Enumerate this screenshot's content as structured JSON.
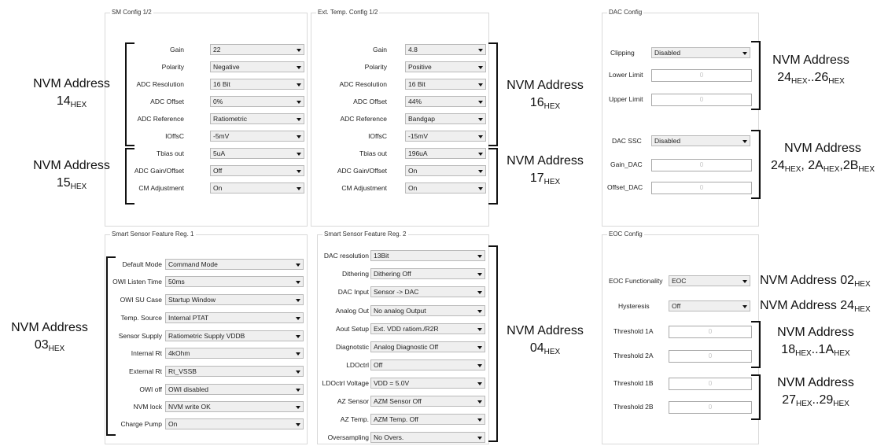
{
  "sm_config": {
    "title": "SM Config 1/2",
    "rows": [
      {
        "label": "Gain",
        "value": "22"
      },
      {
        "label": "Polarity",
        "value": "Negative"
      },
      {
        "label": "ADC Resolution",
        "value": "16 Bit"
      },
      {
        "label": "ADC Offset",
        "value": "0%"
      },
      {
        "label": "ADC Reference",
        "value": "Ratiometric"
      },
      {
        "label": "IOffsC",
        "value": "-5mV"
      },
      {
        "label": "Tbias out",
        "value": "5uA"
      },
      {
        "label": "ADC Gain/Offset",
        "value": "Off"
      },
      {
        "label": "CM Adjustment",
        "value": "On"
      }
    ]
  },
  "ext_temp_config": {
    "title": "Ext. Temp. Config 1/2",
    "rows": [
      {
        "label": "Gain",
        "value": "4.8"
      },
      {
        "label": "Polarity",
        "value": "Positive"
      },
      {
        "label": "ADC Resolution",
        "value": "16 Bit"
      },
      {
        "label": "ADC Offset",
        "value": "44%"
      },
      {
        "label": "ADC Reference",
        "value": "Bandgap"
      },
      {
        "label": "IOffsC",
        "value": "-15mV"
      },
      {
        "label": "Tbias out",
        "value": "196uA"
      },
      {
        "label": "ADC Gain/Offset",
        "value": "On"
      },
      {
        "label": "CM Adjustment",
        "value": "On"
      }
    ]
  },
  "dac_config": {
    "title": "DAC Config",
    "clipping": {
      "label": "Clipping",
      "value": "Disabled"
    },
    "lower_limit": {
      "label": "Lower Limit",
      "value": "0"
    },
    "upper_limit": {
      "label": "Upper Limit",
      "value": "0"
    },
    "dac_ssc": {
      "label": "DAC SSC",
      "value": "Disabled"
    },
    "gain_dac": {
      "label": "Gain_DAC",
      "value": "0"
    },
    "offset_dac": {
      "label": "Offset_DAC",
      "value": "0"
    }
  },
  "ssfr1": {
    "title": "Smart Sensor Feature Reg. 1",
    "rows": [
      {
        "label": "Default Mode",
        "value": "Command Mode"
      },
      {
        "label": "OWI Listen Time",
        "value": "50ms"
      },
      {
        "label": "OWI SU Case",
        "value": "Startup Window"
      },
      {
        "label": "Temp. Source",
        "value": "Internal PTAT"
      },
      {
        "label": "Sensor Supply",
        "value": "Ratiometric Supply VDDB"
      },
      {
        "label": "Internal Rt",
        "value": "4kOhm"
      },
      {
        "label": "External Rt",
        "value": "Rt_VSSB"
      },
      {
        "label": "OWI off",
        "value": "OWI disabled"
      },
      {
        "label": "NVM lock",
        "value": "NVM write OK"
      },
      {
        "label": "Charge Pump",
        "value": "On"
      }
    ]
  },
  "ssfr2": {
    "title": "Smart Sensor Feature Reg. 2",
    "rows": [
      {
        "label": "DAC resolution",
        "value": "13Bit"
      },
      {
        "label": "Dithering",
        "value": "Dithering Off"
      },
      {
        "label": "DAC Input",
        "value": "Sensor -> DAC"
      },
      {
        "label": "Analog Out",
        "value": "No analog Output"
      },
      {
        "label": "Aout Setup",
        "value": "Ext. VDD ratiom./R2R"
      },
      {
        "label": "Diagnotstic",
        "value": "Analog Diagnostic Off"
      },
      {
        "label": "LDOctrl",
        "value": "Off"
      },
      {
        "label": "LDOctrl Voltage",
        "value": "VDD = 5.0V"
      },
      {
        "label": "AZ Sensor",
        "value": "AZM Sensor Off"
      },
      {
        "label": "AZ Temp.",
        "value": "AZM Temp. Off"
      },
      {
        "label": "Oversampling",
        "value": "No Overs."
      }
    ]
  },
  "eoc_config": {
    "title": "EOC Config",
    "eoc_functionality": {
      "label": "EOC Functionality",
      "value": "EOC"
    },
    "hysteresis": {
      "label": "Hysteresis",
      "value": "Off"
    },
    "threshold_1a": {
      "label": "Threshold 1A",
      "value": "0"
    },
    "threshold_2a": {
      "label": "Threshold 2A",
      "value": "0"
    },
    "threshold_1b": {
      "label": "Threshold 1B",
      "value": "0"
    },
    "threshold_2b": {
      "label": "Threshold 2B",
      "value": "0"
    }
  },
  "annotations": {
    "nvm_label": "NVM Address",
    "hex": "HEX",
    "a14": "14",
    "a15": "15",
    "a16": "16",
    "a17": "17",
    "a03": "03",
    "a04": "04",
    "a02": "02",
    "a24": "24",
    "a24_26_lo": "24",
    "a24_26_sep": "..",
    "a24_26_hi": "26",
    "a24_2a_2b_1": "24",
    "a24_2a_2b_sep1": ", ",
    "a24_2a_2b_2": "2A",
    "a24_2a_2b_sep2": ",",
    "a24_2a_2b_3": "2B",
    "a18_1a_lo": "18",
    "a18_1a_sep": "..",
    "a18_1a_hi": "1A",
    "a27_29_lo": "27",
    "a27_29_sep": "..",
    "a27_29_hi": "29"
  }
}
